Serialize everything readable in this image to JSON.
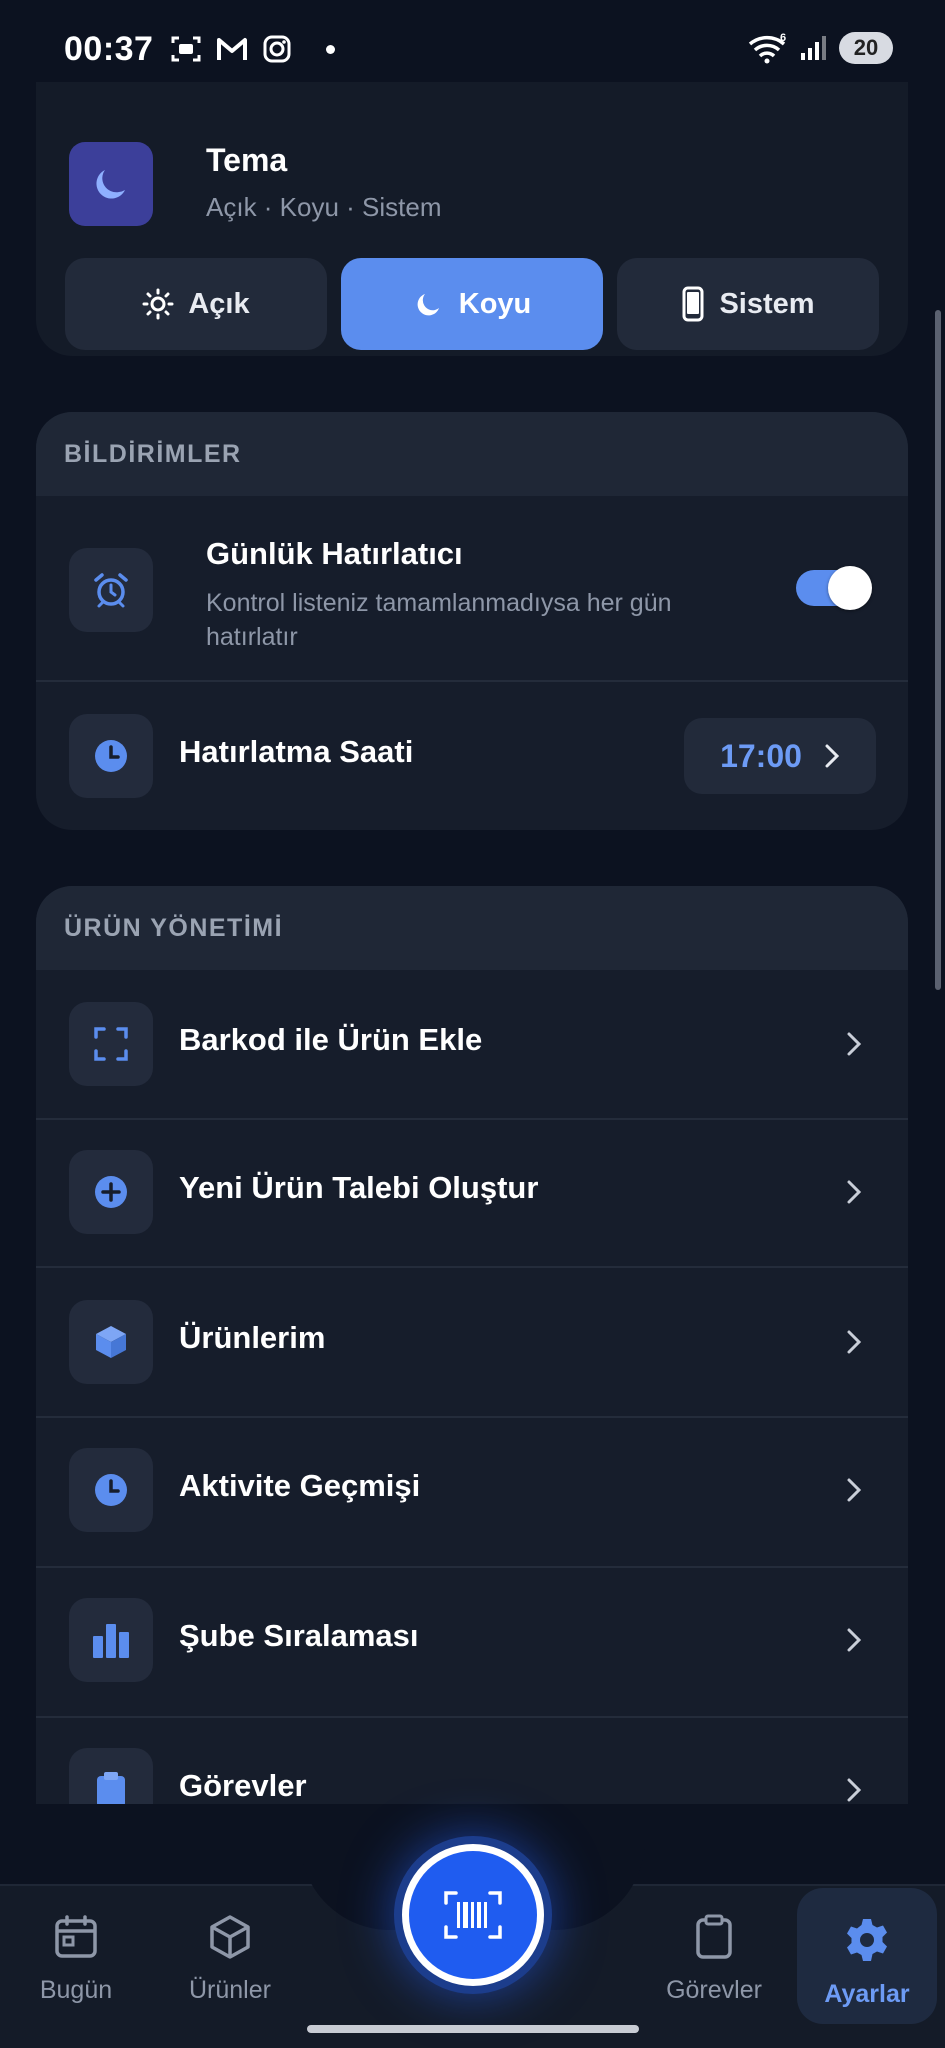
{
  "status_bar": {
    "time": "00:37",
    "battery": "20",
    "left_icons": [
      "screenshot-icon",
      "gmail-icon",
      "instagram-icon",
      "notification-dot"
    ],
    "right_icons": [
      "wifi-icon",
      "signal-icon",
      "battery-icon"
    ]
  },
  "theme": {
    "title": "Tema",
    "subtitle": "Açık · Koyu · Sistem",
    "options": [
      {
        "label": "Açık",
        "icon": "sun-icon"
      },
      {
        "label": "Koyu",
        "icon": "moon-icon",
        "active": true
      },
      {
        "label": "Sistem",
        "icon": "phone-icon"
      }
    ]
  },
  "notifications": {
    "header": "BİLDİRİMLER",
    "daily_reminder": {
      "title": "Günlük Hatırlatıcı",
      "description": "Kontrol listeniz tamamlanmadıysa her gün hatırlatır",
      "enabled": true
    },
    "reminder_time": {
      "label": "Hatırlatma Saati",
      "value": "17:00"
    }
  },
  "product_management": {
    "header": "ÜRÜN YÖNETİMİ",
    "items": [
      {
        "label": "Barkod ile Ürün Ekle",
        "icon": "scan-frame-icon"
      },
      {
        "label": "Yeni Ürün Talebi Oluştur",
        "icon": "plus-circle-icon"
      },
      {
        "label": "Ürünlerim",
        "icon": "cube-icon"
      },
      {
        "label": "Aktivite Geçmişi",
        "icon": "clock-icon"
      },
      {
        "label": "Şube Sıralaması",
        "icon": "bar-chart-icon"
      },
      {
        "label": "Görevler",
        "icon": "clipboard-icon"
      }
    ]
  },
  "bottom_nav": {
    "items": [
      {
        "label": "Bugün",
        "icon": "calendar-icon"
      },
      {
        "label": "Ürünler",
        "icon": "box-icon"
      },
      {
        "label": "Görevler",
        "icon": "clipboard-icon"
      },
      {
        "label": "Ayarlar",
        "icon": "gear-icon",
        "active": true
      }
    ],
    "center_action": "barcode-scan-icon"
  },
  "colors": {
    "background": "#0c1220",
    "card": "#161d2b",
    "accent": "#5b8dee",
    "text_primary": "#ffffff",
    "text_secondary": "#8e97a8"
  }
}
